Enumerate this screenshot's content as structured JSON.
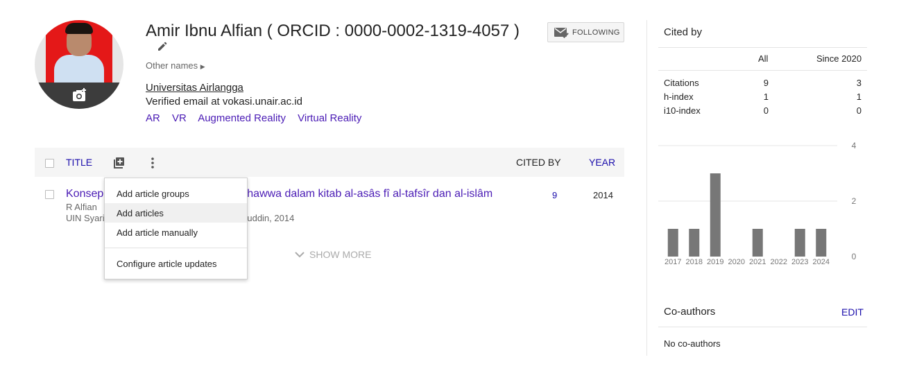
{
  "profile": {
    "name": "Amir Ibnu Alfian ( ORCID : 0000-0002-1319-4057 )",
    "other_names": "Other names",
    "affiliation": "Universitas Airlangga",
    "email": "Verified email at vokasi.unair.ac.id",
    "interests": [
      "AR",
      "VR",
      "Augmented Reality",
      "Virtual Reality"
    ],
    "follow_label": "FOLLOWING"
  },
  "articles": {
    "header": {
      "title": "TITLE",
      "cited_by": "CITED BY",
      "year": "YEAR"
    },
    "rows": [
      {
        "title": "Konsep penciptaan adam dan hawwa dalam kitab al-asâs fî al-tafsîr dan al-islâm",
        "title_visible_prefix": "Konsep",
        "title_visible_suffix": "l hawwa dalam kitab al-asâs fî al-tafsîr dan al-islâm",
        "authors": "R Alfian",
        "venue_prefix": "UIN Syari",
        "venue_suffix": "ıuluddin, 2014",
        "cited_by": "9",
        "year": "2014"
      }
    ],
    "show_more": "SHOW MORE"
  },
  "menu": {
    "items": [
      "Add article groups",
      "Add articles",
      "Add article manually",
      "Configure article updates"
    ],
    "highlighted_index": 1
  },
  "cited_by": {
    "title": "Cited by",
    "col_all": "All",
    "col_since": "Since 2020",
    "stats": [
      {
        "label": "Citations",
        "all": "9",
        "since": "3"
      },
      {
        "label": "h-index",
        "all": "1",
        "since": "1"
      },
      {
        "label": "i10-index",
        "all": "0",
        "since": "0"
      }
    ]
  },
  "chart_data": {
    "type": "bar",
    "categories": [
      "2017",
      "2018",
      "2019",
      "2020",
      "2021",
      "2022",
      "2023",
      "2024"
    ],
    "values": [
      1,
      1,
      3,
      0,
      1,
      0,
      1,
      1
    ],
    "ylim": [
      0,
      4
    ],
    "yticks": [
      "0",
      "2",
      "4"
    ],
    "bar_color": "#777777",
    "grid": true
  },
  "coauthors": {
    "title": "Co-authors",
    "edit_label": "EDIT",
    "empty_text": "No co-authors"
  }
}
